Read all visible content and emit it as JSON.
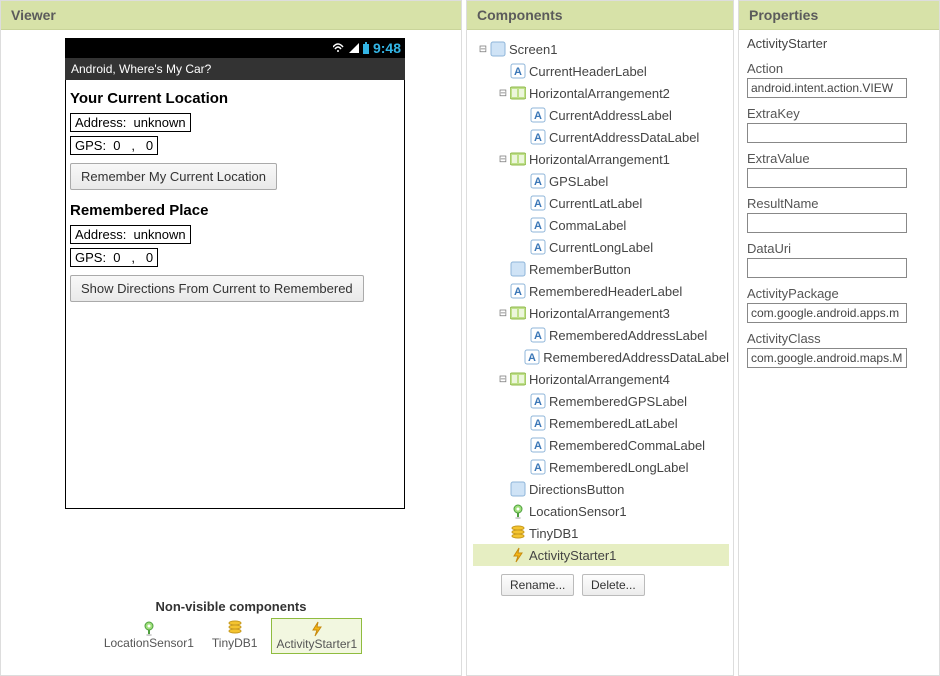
{
  "panels": {
    "viewer": "Viewer",
    "components": "Components",
    "properties": "Properties"
  },
  "status": {
    "time": "9:48"
  },
  "app": {
    "title": "Android, Where's My Car?",
    "currentHeader": "Your Current Location",
    "row1": {
      "addressLabel": "Address:  ",
      "addressData": "unknown"
    },
    "row2": {
      "gpsLabel": "GPS:  ",
      "lat": "0",
      "comma": "   ,   ",
      "lon": "0"
    },
    "rememberBtn": "Remember My Current Location",
    "rememberedHeader": "Remembered Place",
    "row3": {
      "addressLabel": "Address:  ",
      "addressData": "unknown"
    },
    "row4": {
      "gpsLabel": "GPS:  ",
      "lat": "0",
      "comma": "   ,   ",
      "lon": "0"
    },
    "directionsBtn": "Show Directions From Current to Remembered"
  },
  "nonvisible": {
    "title": "Non-visible components",
    "items": [
      {
        "icon": "location",
        "name": "LocationSensor1"
      },
      {
        "icon": "db",
        "name": "TinyDB1"
      },
      {
        "icon": "bolt",
        "name": "ActivityStarter1",
        "selected": true
      }
    ]
  },
  "tree": [
    {
      "d": 0,
      "exp": "minus",
      "icon": "form",
      "label": "Screen1"
    },
    {
      "d": 1,
      "exp": "none",
      "icon": "label",
      "label": "CurrentHeaderLabel"
    },
    {
      "d": 1,
      "exp": "minus",
      "icon": "harr",
      "label": "HorizontalArrangement2"
    },
    {
      "d": 2,
      "exp": "none",
      "icon": "label",
      "label": "CurrentAddressLabel"
    },
    {
      "d": 2,
      "exp": "none",
      "icon": "label",
      "label": "CurrentAddressDataLabel"
    },
    {
      "d": 1,
      "exp": "minus",
      "icon": "harr",
      "label": "HorizontalArrangement1"
    },
    {
      "d": 2,
      "exp": "none",
      "icon": "label",
      "label": "GPSLabel"
    },
    {
      "d": 2,
      "exp": "none",
      "icon": "label",
      "label": "CurrentLatLabel"
    },
    {
      "d": 2,
      "exp": "none",
      "icon": "label",
      "label": "CommaLabel"
    },
    {
      "d": 2,
      "exp": "none",
      "icon": "label",
      "label": "CurrentLongLabel"
    },
    {
      "d": 1,
      "exp": "none",
      "icon": "form",
      "label": "RememberButton"
    },
    {
      "d": 1,
      "exp": "none",
      "icon": "label",
      "label": "RememberedHeaderLabel"
    },
    {
      "d": 1,
      "exp": "minus",
      "icon": "harr",
      "label": "HorizontalArrangement3"
    },
    {
      "d": 2,
      "exp": "none",
      "icon": "label",
      "label": "RememberedAddressLabel"
    },
    {
      "d": 2,
      "exp": "none",
      "icon": "label",
      "label": "RememberedAddressDataLabel"
    },
    {
      "d": 1,
      "exp": "minus",
      "icon": "harr",
      "label": "HorizontalArrangement4"
    },
    {
      "d": 2,
      "exp": "none",
      "icon": "label",
      "label": "RememberedGPSLabel"
    },
    {
      "d": 2,
      "exp": "none",
      "icon": "label",
      "label": "RememberedLatLabel"
    },
    {
      "d": 2,
      "exp": "none",
      "icon": "label",
      "label": "RememberedCommaLabel"
    },
    {
      "d": 2,
      "exp": "none",
      "icon": "label",
      "label": "RememberedLongLabel"
    },
    {
      "d": 1,
      "exp": "none",
      "icon": "form",
      "label": "DirectionsButton"
    },
    {
      "d": 1,
      "exp": "none",
      "icon": "location",
      "label": "LocationSensor1"
    },
    {
      "d": 1,
      "exp": "none",
      "icon": "db",
      "label": "TinyDB1"
    },
    {
      "d": 1,
      "exp": "none",
      "icon": "bolt",
      "label": "ActivityStarter1",
      "selected": true
    }
  ],
  "treeButtons": {
    "rename": "Rename...",
    "delete": "Delete..."
  },
  "properties": {
    "componentName": "ActivityStarter",
    "fields": [
      {
        "label": "Action",
        "value": "android.intent.action.VIEW"
      },
      {
        "label": "ExtraKey",
        "value": ""
      },
      {
        "label": "ExtraValue",
        "value": ""
      },
      {
        "label": "ResultName",
        "value": ""
      },
      {
        "label": "DataUri",
        "value": ""
      },
      {
        "label": "ActivityPackage",
        "value": "com.google.android.apps.m"
      },
      {
        "label": "ActivityClass",
        "value": "com.google.android.maps.M"
      }
    ]
  }
}
